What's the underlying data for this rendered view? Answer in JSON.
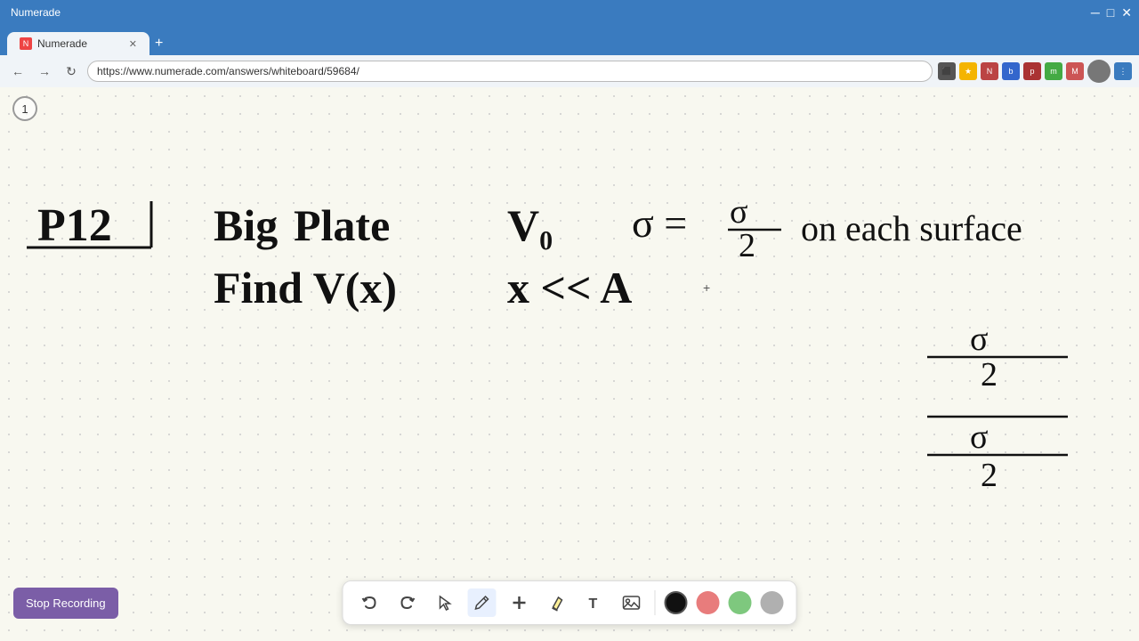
{
  "browser": {
    "tab_title": "Numerade",
    "url": "https://www.numerade.com/answers/whiteboard/59684/",
    "new_tab_label": "+",
    "nav_back": "←",
    "nav_forward": "→",
    "nav_refresh": "↺"
  },
  "page": {
    "number": "1",
    "title": "P12",
    "problem_line1": "Big Plate    V₀    σ = σ/2 on each surface",
    "problem_line2": "Find  V(x)    x << A"
  },
  "toolbar": {
    "undo_label": "↺",
    "redo_label": "↻",
    "select_label": "↖",
    "pen_label": "✏",
    "add_label": "+",
    "highlight_label": "⌇",
    "text_label": "T",
    "image_label": "🖼",
    "colors": [
      "#000000",
      "#e87c7c",
      "#7ec87e",
      "#b0b0b0"
    ]
  },
  "stop_recording": {
    "label": "Stop Recording"
  }
}
